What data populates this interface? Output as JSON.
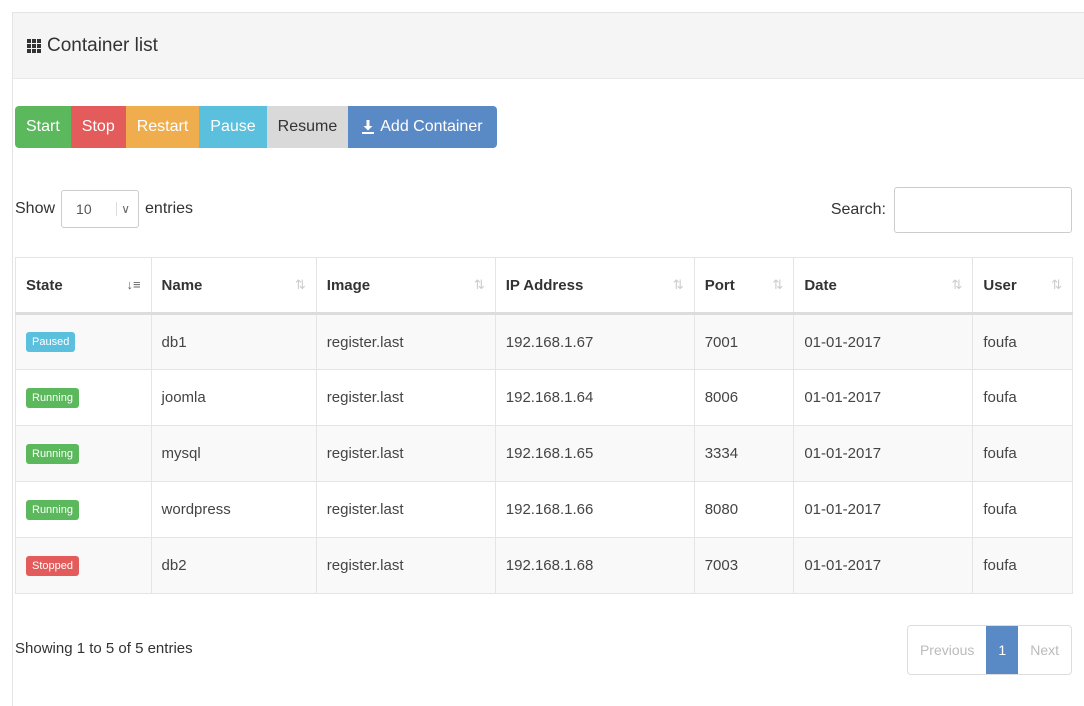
{
  "panel": {
    "title": "Container list",
    "title_icon": "grid-icon"
  },
  "toolbar": {
    "start": "Start",
    "stop": "Stop",
    "restart": "Restart",
    "pause": "Pause",
    "resume": "Resume",
    "add": "Add Container",
    "add_icon": "download-icon"
  },
  "length": {
    "show": "Show",
    "value": "10",
    "entries": "entries"
  },
  "search": {
    "label": "Search:",
    "value": ""
  },
  "table": {
    "columns": [
      "State",
      "Name",
      "Image",
      "IP Address",
      "Port",
      "Date",
      "User"
    ],
    "rows": [
      {
        "state": "Paused",
        "name": "db1",
        "image": "register.last",
        "ip": "192.168.1.67",
        "port": "7001",
        "date": "01-01-2017",
        "user": "foufa"
      },
      {
        "state": "Running",
        "name": "joomla",
        "image": "register.last",
        "ip": "192.168.1.64",
        "port": "8006",
        "date": "01-01-2017",
        "user": "foufa"
      },
      {
        "state": "Running",
        "name": "mysql",
        "image": "register.last",
        "ip": "192.168.1.65",
        "port": "3334",
        "date": "01-01-2017",
        "user": "foufa"
      },
      {
        "state": "Running",
        "name": "wordpress",
        "image": "register.last",
        "ip": "192.168.1.66",
        "port": "8080",
        "date": "01-01-2017",
        "user": "foufa"
      },
      {
        "state": "Stopped",
        "name": "db2",
        "image": "register.last",
        "ip": "192.168.1.68",
        "port": "7003",
        "date": "01-01-2017",
        "user": "foufa"
      }
    ]
  },
  "footer": {
    "info": "Showing 1 to 5 of 5 entries",
    "previous": "Previous",
    "page": "1",
    "next": "Next"
  },
  "colors": {
    "paused": "#5bc0de",
    "running": "#5cb85c",
    "stopped": "#e35b5b",
    "primary": "#5a8ac6"
  }
}
